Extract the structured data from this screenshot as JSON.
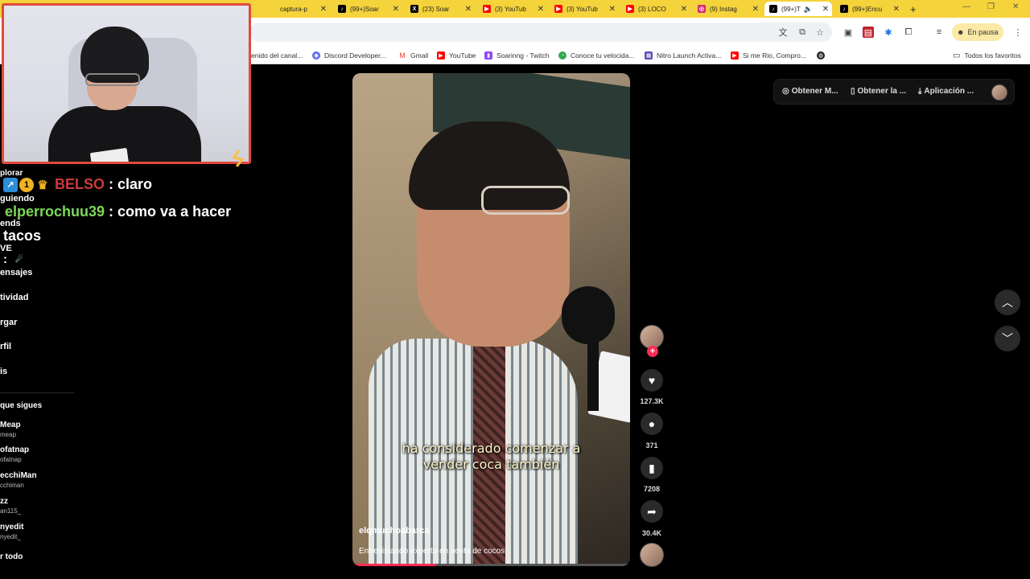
{
  "tabs": [
    {
      "label": "captura-p",
      "icon": "page-icon",
      "color": "#888888"
    },
    {
      "label": "(99+)Soar",
      "icon": "tiktok-icon",
      "color": "#000000"
    },
    {
      "label": "(23) Soar",
      "icon": "x-icon",
      "color": "#000000"
    },
    {
      "label": "(3) YouTub",
      "icon": "youtube-icon",
      "color": "#ff0000"
    },
    {
      "label": "(3) YouTub",
      "icon": "youtube-icon",
      "color": "#ff0000"
    },
    {
      "label": "(3) LOCO",
      "icon": "youtube-icon",
      "color": "#ff0000"
    },
    {
      "label": "(9) Instag",
      "icon": "instagram-icon",
      "color": "#d62976"
    },
    {
      "label": "(99+)T",
      "icon": "tiktok-icon",
      "color": "#000000"
    },
    {
      "label": "(99+)Encu",
      "icon": "tiktok-icon",
      "color": "#000000"
    }
  ],
  "new_tab": "+",
  "toolbar": {
    "pause_label": "En pausa"
  },
  "bookmarks": [
    {
      "label": "enido del canal...",
      "icon": "bookmark-icon",
      "color": "#777777"
    },
    {
      "label": "Discord Developer...",
      "icon": "discord-icon",
      "color": "#5865f2"
    },
    {
      "label": "Gmail",
      "icon": "gmail-icon",
      "color": "#ea4335"
    },
    {
      "label": "YouTube",
      "icon": "youtube-icon",
      "color": "#ff0000"
    },
    {
      "label": "Soarinng - Twitch",
      "icon": "twitch-icon",
      "color": "#9146ff"
    },
    {
      "label": "Conoce tu velocida...",
      "icon": "speed-icon",
      "color": "#34a853"
    },
    {
      "label": "Nitro Launch Activa...",
      "icon": "nitro-icon",
      "color": "#5b4bb7"
    },
    {
      "label": "Si me Rio, Compro...",
      "icon": "youtube-icon",
      "color": "#ff0000"
    }
  ],
  "all_bookmarks": "Todos los favoritos",
  "sidebar": {
    "items": [
      "plorar",
      "guiendo",
      "ends",
      "VE",
      "ensajes",
      "tividad",
      "rgar",
      "rfil",
      "is"
    ],
    "following_header": "que sigues",
    "following": [
      {
        "name": "Meap",
        "handle": "meap"
      },
      {
        "name": "ofatnap",
        "handle": "ofatnap"
      },
      {
        "name": "ecchiMan",
        "handle": "cchiman"
      },
      {
        "name": "zz",
        "handle": "an115_"
      },
      {
        "name": "nyedit",
        "handle": "nyedit_"
      }
    ],
    "see_all": "r todo"
  },
  "chat": [
    {
      "user": "BELSO",
      "user_color": "#c93a3a",
      "message": ": claro"
    },
    {
      "user": "elperrochuu39",
      "user_color": "#7ed957",
      "message": ": como va a hacer"
    },
    {
      "user": "",
      "user_color": "#ffffff",
      "message": "tacos"
    },
    {
      "user": "",
      "user_color": "#ffffff",
      "message": ":"
    }
  ],
  "video": {
    "caption_line1": "ha considerado comenzar a",
    "caption_line2": "vender coca también",
    "username": "elqmuchoabarca",
    "description": "Entrevistando experto en venta de cocos",
    "progress": 0.3
  },
  "actions": {
    "likes": "127.3K",
    "comments": "371",
    "saves": "7208",
    "shares": "30.4K"
  },
  "top_nav": [
    {
      "label": "Obtener M...",
      "icon": "coin-icon"
    },
    {
      "label": "Obtener la ...",
      "icon": "phone-icon"
    },
    {
      "label": "Aplicación ...",
      "icon": "download-icon"
    }
  ],
  "colors": {
    "accent": "#fe2c55",
    "tab_bar": "#f5d33b",
    "webcam_border": "#e04a3a"
  }
}
